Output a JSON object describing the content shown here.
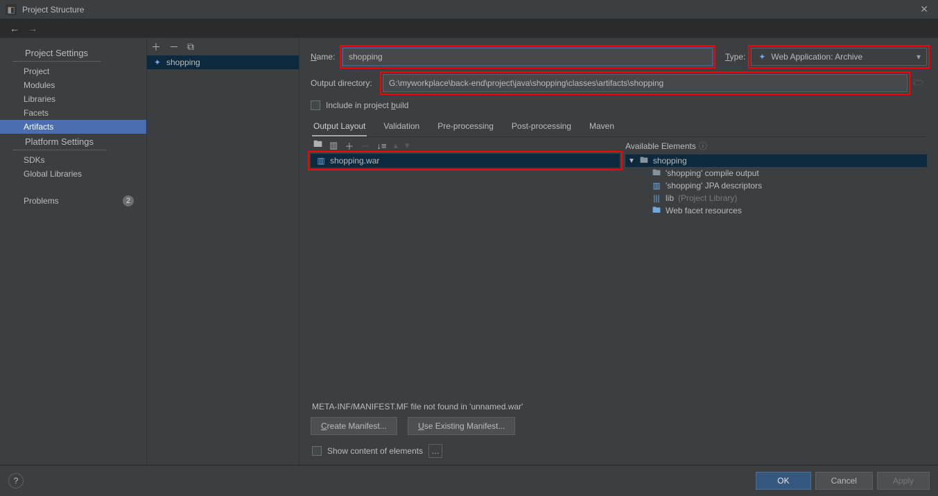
{
  "window": {
    "title": "Project Structure"
  },
  "sidebar": {
    "section_project": "Project Settings",
    "section_platform": "Platform Settings",
    "items_project": [
      {
        "label": "Project"
      },
      {
        "label": "Modules"
      },
      {
        "label": "Libraries"
      },
      {
        "label": "Facets"
      },
      {
        "label": "Artifacts"
      }
    ],
    "items_platform": [
      {
        "label": "SDKs"
      },
      {
        "label": "Global Libraries"
      }
    ],
    "problems": {
      "label": "Problems",
      "count": "2"
    }
  },
  "artifacts": {
    "item": "shopping"
  },
  "form": {
    "name_label": "Name:",
    "name_value": "shopping",
    "type_label": "Type:",
    "type_value": "Web Application: Archive",
    "outdir_label": "Output directory:",
    "outdir_value": "G:\\myworkplace\\back-end\\project\\java\\shopping\\classes\\artifacts\\shopping",
    "include_label": "Include in project build"
  },
  "tabs": {
    "t0": "Output Layout",
    "t1": "Validation",
    "t2": "Pre-processing",
    "t3": "Post-processing",
    "t4": "Maven"
  },
  "output": {
    "war": "shopping.war"
  },
  "available": {
    "header": "Available Elements",
    "root": "shopping",
    "children": [
      {
        "label": "'shopping' compile output"
      },
      {
        "label": "'shopping' JPA descriptors"
      },
      {
        "label": "lib",
        "suffix": "(Project Library)"
      },
      {
        "label": "Web facet resources"
      }
    ]
  },
  "manifest": {
    "msg": "META-INF/MANIFEST.MF file not found in 'unnamed.war'",
    "create": "Create Manifest...",
    "use": "Use Existing Manifest..."
  },
  "bottom": {
    "show_label": "Show content of elements"
  },
  "footer": {
    "ok": "OK",
    "cancel": "Cancel",
    "apply": "Apply"
  }
}
